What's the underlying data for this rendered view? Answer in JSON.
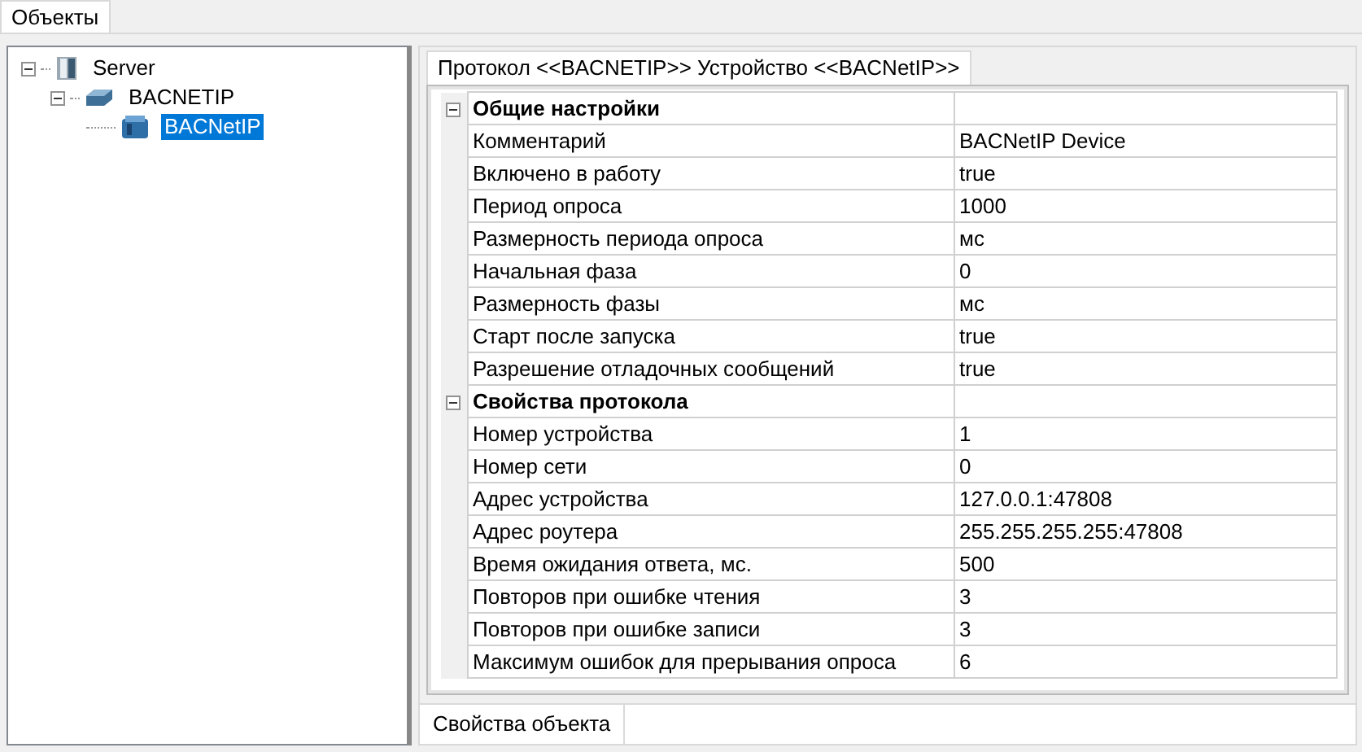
{
  "top_tabs": [
    {
      "label": "Объекты",
      "selected": true
    }
  ],
  "tree": [
    {
      "label": "Server",
      "kind": "server",
      "expanded": true,
      "selected": false,
      "children": [
        {
          "label": "BACNETIP",
          "kind": "protocol",
          "expanded": true,
          "selected": false,
          "children": [
            {
              "label": "BACNetIP",
              "kind": "device",
              "selected": true
            }
          ]
        }
      ]
    }
  ],
  "editor_tabs": [
    {
      "label": "Протокол <<BACNETIP>> Устройство <<BACNetIP>>",
      "selected": true
    }
  ],
  "property_grid": [
    {
      "title": "Общие настройки",
      "expanded": true,
      "rows": [
        {
          "name": "Комментарий",
          "value": "BACNetIP Device"
        },
        {
          "name": "Включено в работу",
          "value": "true"
        },
        {
          "name": "Период опроса",
          "value": "1000"
        },
        {
          "name": "Размерность периода опроса",
          "value": "мс"
        },
        {
          "name": "Начальная фаза",
          "value": "0"
        },
        {
          "name": "Размерность фазы",
          "value": "мс"
        },
        {
          "name": "Старт после запуска",
          "value": "true"
        },
        {
          "name": "Разрешение отладочных сообщений",
          "value": "true"
        }
      ]
    },
    {
      "title": "Свойства протокола",
      "expanded": true,
      "rows": [
        {
          "name": "Номер устройства",
          "value": "1"
        },
        {
          "name": "Номер сети",
          "value": "0"
        },
        {
          "name": "Адрес устройства",
          "value": "127.0.0.1:47808"
        },
        {
          "name": "Адрес роутера",
          "value": "255.255.255.255:47808"
        },
        {
          "name": "Время ожидания ответа, мс.",
          "value": "500"
        },
        {
          "name": "Повторов при ошибке чтения",
          "value": "3"
        },
        {
          "name": "Повторов при ошибке записи",
          "value": "3"
        },
        {
          "name": "Максимум ошибок для прерывания опроса",
          "value": "6"
        }
      ]
    }
  ],
  "bottom_tabs": [
    {
      "label": "Свойства объекта",
      "selected": true
    }
  ]
}
